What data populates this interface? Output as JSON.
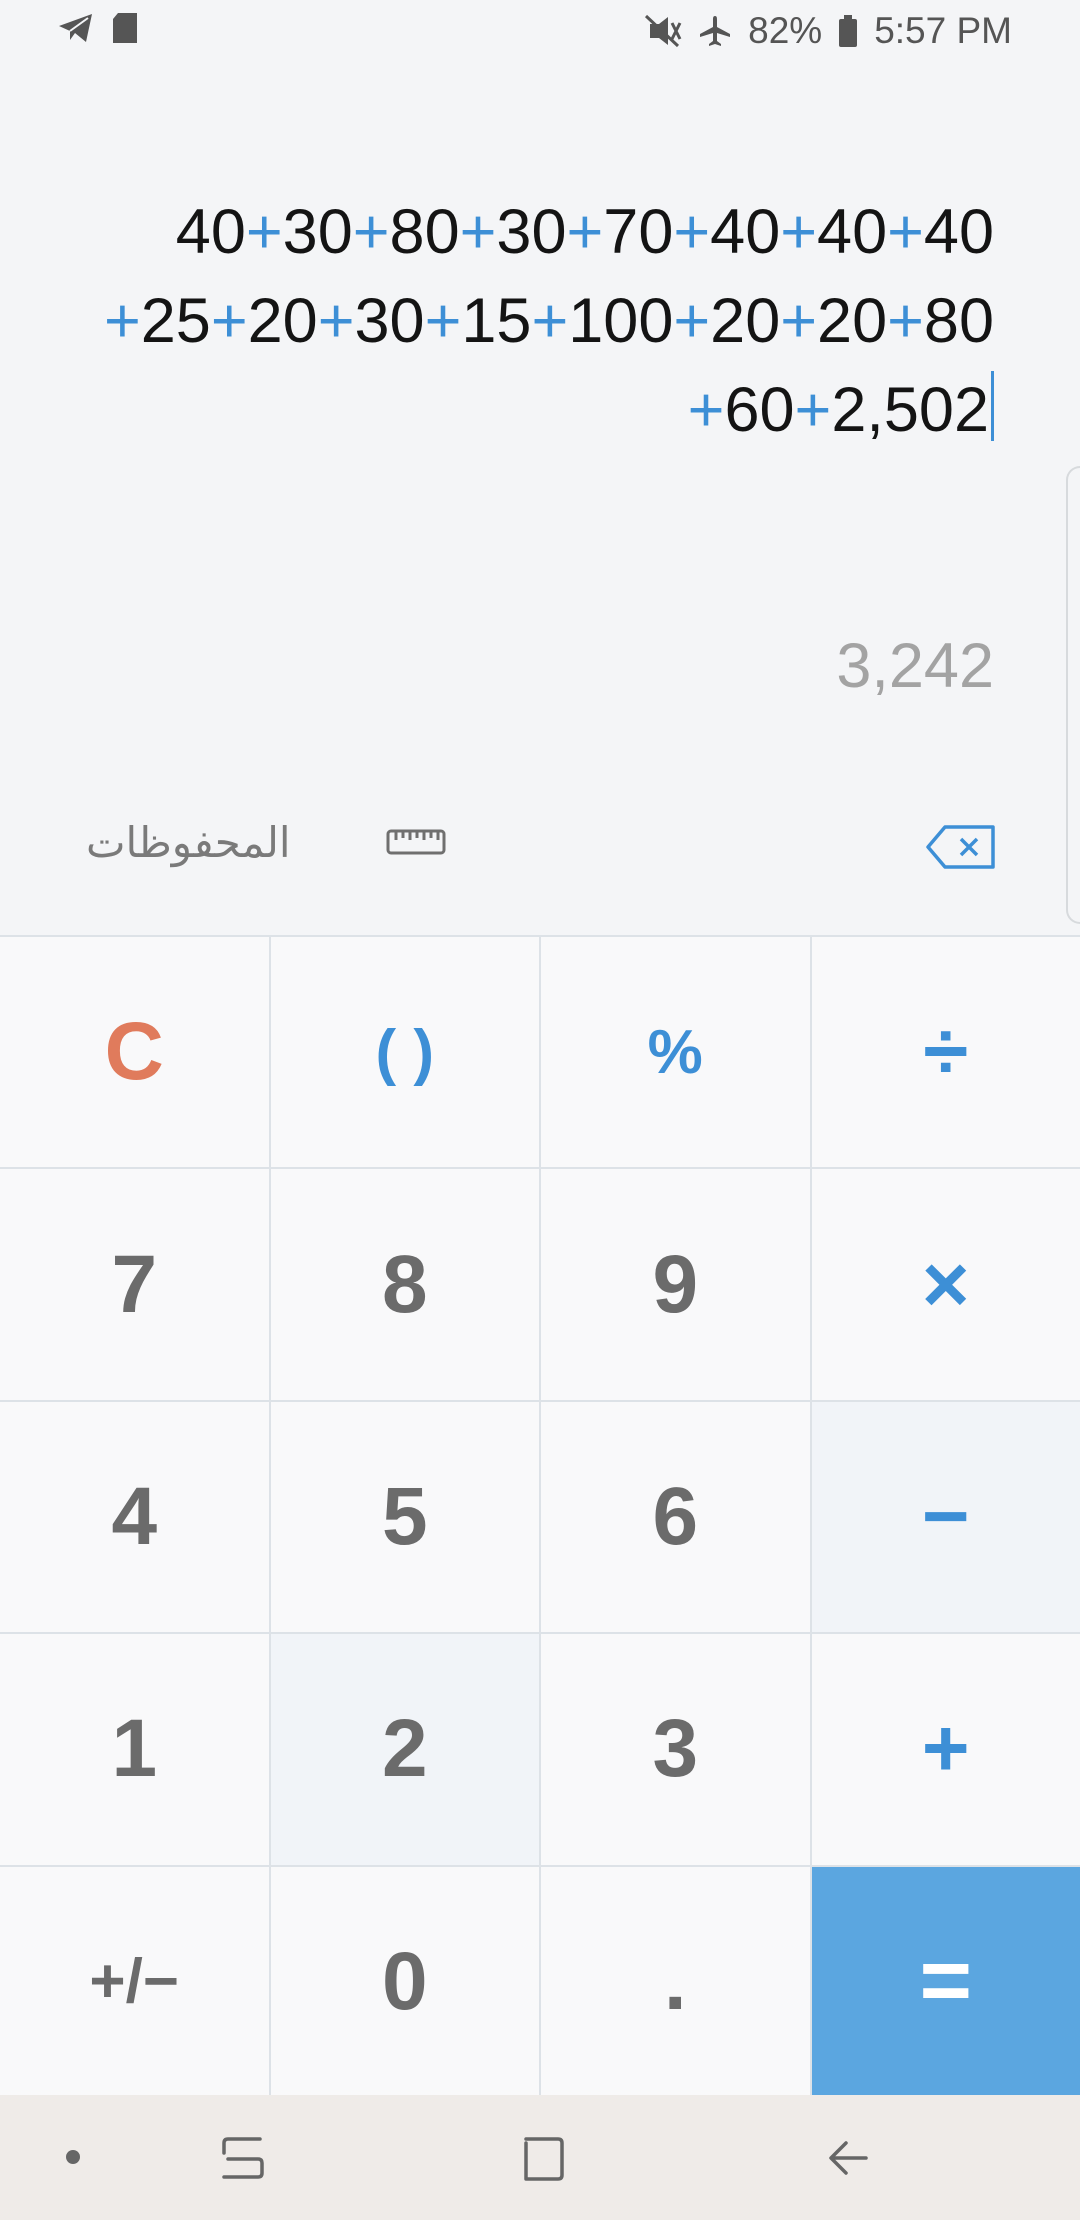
{
  "status_bar": {
    "battery": "82%",
    "time": "5:57 PM",
    "icons": [
      "telegram-icon",
      "sd-card-icon",
      "mute-vibrate-icon",
      "airplane-icon",
      "battery-icon"
    ]
  },
  "display": {
    "expression_lines": [
      [
        "40",
        "+",
        "30",
        "+",
        "80",
        "+",
        "30",
        "+",
        "70",
        "+",
        "40",
        "+",
        "40",
        "+",
        "40"
      ],
      [
        "+",
        "25",
        "+",
        "20",
        "+",
        "30",
        "+",
        "15",
        "+",
        "100",
        "+",
        "20",
        "+",
        "20",
        "+",
        "80"
      ],
      [
        "+",
        "60",
        "+",
        "2,502"
      ]
    ],
    "result": "3,242"
  },
  "tools": {
    "history_label": "المحفوظات",
    "converter_icon": "ruler-icon",
    "backspace_icon": "backspace-icon"
  },
  "keypad": {
    "rows": [
      [
        "C",
        "( )",
        "%",
        "÷"
      ],
      [
        "7",
        "8",
        "9",
        "×"
      ],
      [
        "4",
        "5",
        "6",
        "−"
      ],
      [
        "1",
        "2",
        "3",
        "+"
      ],
      [
        "+/−",
        "0",
        ".",
        "="
      ]
    ]
  },
  "colors": {
    "operator": "#3d8fd6",
    "clear": "#e07b5c",
    "equals_bg": "#5ba6e0",
    "digit": "#6b6b6b",
    "result": "#a3a3a3"
  },
  "nav_bar": {
    "icons": [
      "nav-dot-icon",
      "recents-icon",
      "home-icon",
      "back-icon"
    ]
  }
}
